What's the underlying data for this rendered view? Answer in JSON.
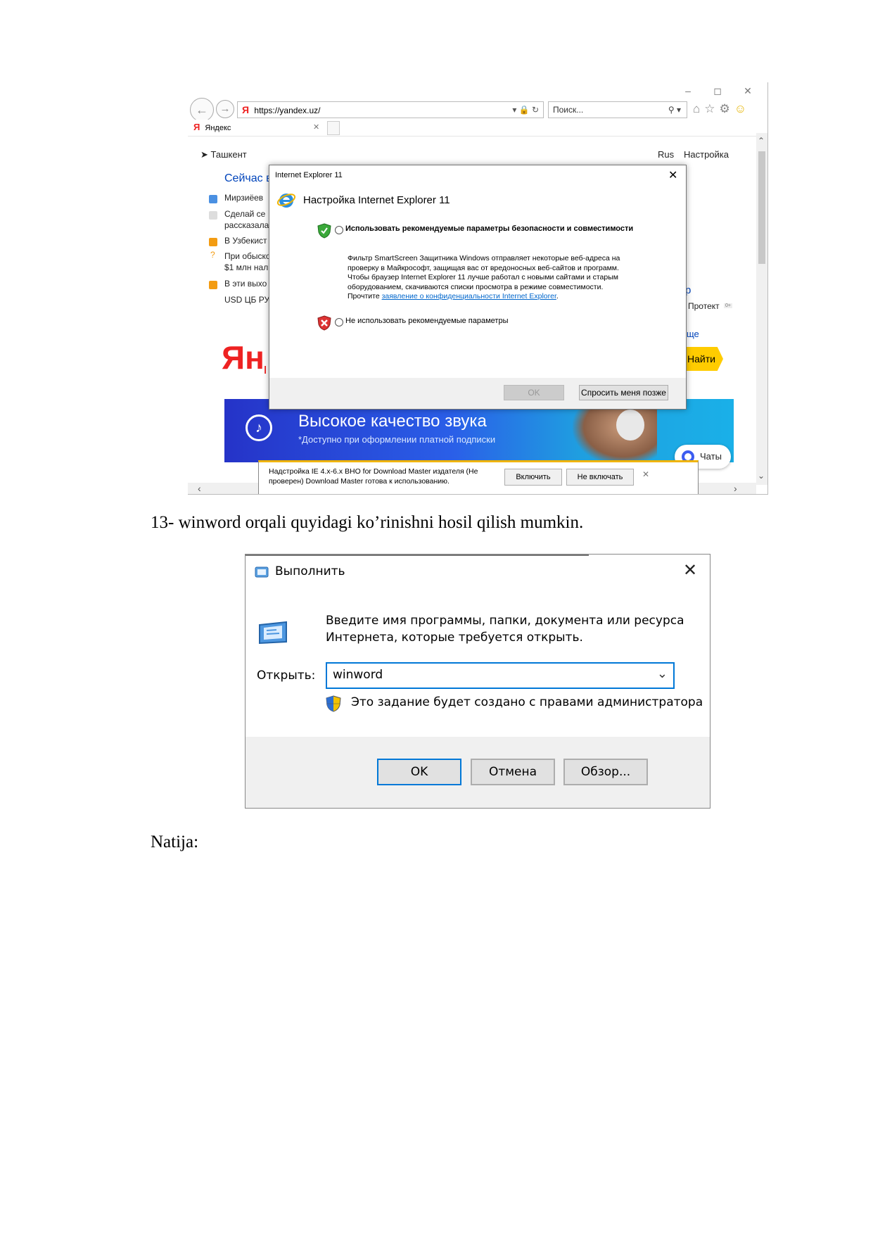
{
  "ie": {
    "address": "https://yandex.uz/",
    "search_placeholder": "Поиск...",
    "tab_title": "Яндекс",
    "tab_logo": "Я",
    "addr_logo": "Я",
    "window_icons": [
      "minimize-icon",
      "maximize-icon",
      "close-icon"
    ],
    "page": {
      "city": "Ташкент",
      "lang": "Rus",
      "settings": "Настройка",
      "news_head": "Сейчас в",
      "news": [
        "Мирзиёев",
        "Сделай се",
        "рассказала",
        "В Узбекист",
        "При обыско",
        "$1 млн нал",
        "В эти выхо"
      ],
      "usd": "USD ЦБ РУ",
      "logo": "Яндекс",
      "right_p": "р",
      "protect": "Протект",
      "protect_badge": "0+",
      "more": "ще",
      "find_btn": "Найти",
      "banner_title": "Высокое качество звука",
      "banner_sub": "*Доступно при оформлении платной подписки",
      "chats": "Чаты"
    },
    "dialog": {
      "title": "Internet Explorer 11",
      "heading": "Настройка Internet Explorer 11",
      "option1": "Использовать рекомендуемые параметры безопасности и совместимости",
      "desc_lines": [
        "Фильтр SmartScreen Защитника Windows отправляет некоторые веб-адреса на",
        "проверку в Майкрософт, защищая вас от вредоносных веб-сайтов и программ.",
        "Чтобы браузер Internet Explorer 11 лучше работал с новыми сайтами и старым",
        "оборудованием, скачиваются списки просмотра в режиме совместимости."
      ],
      "desc_read": "Прочтите",
      "desc_link": "заявление о конфиденциальности Internet Explorer",
      "desc_end": ".",
      "option2": "Не использовать рекомендуемые параметры",
      "ok": "OK",
      "ask_later": "Спросить меня позже"
    },
    "notification": {
      "line1": "Надстройка IE 4.x-6.x BHO for Download Master издателя (Не",
      "line2": "проверен) Download Master готова к использованию.",
      "enable": "Включить",
      "disable": "Не включать"
    }
  },
  "paragraph1": "13- winword orqali quyidagi ko’rinishni hosil qilish mumkin.",
  "run": {
    "title": "Выполнить",
    "desc_line1": "Введите имя программы, папки, документа или ресурса",
    "desc_line2": "Интернета, которые требуется открыть.",
    "open_label": "Открыть:",
    "input_value": "winword",
    "admin_note": "Это задание будет создано с правами администратора",
    "ok": "OK",
    "cancel": "Отмена",
    "browse": "Обзор..."
  },
  "paragraph2": "Natija:",
  "colors": {
    "yandex_red": "#e22",
    "yandex_yellow": "#ffcc00",
    "link_blue": "#0066cc",
    "focus_blue": "#0078d7"
  }
}
